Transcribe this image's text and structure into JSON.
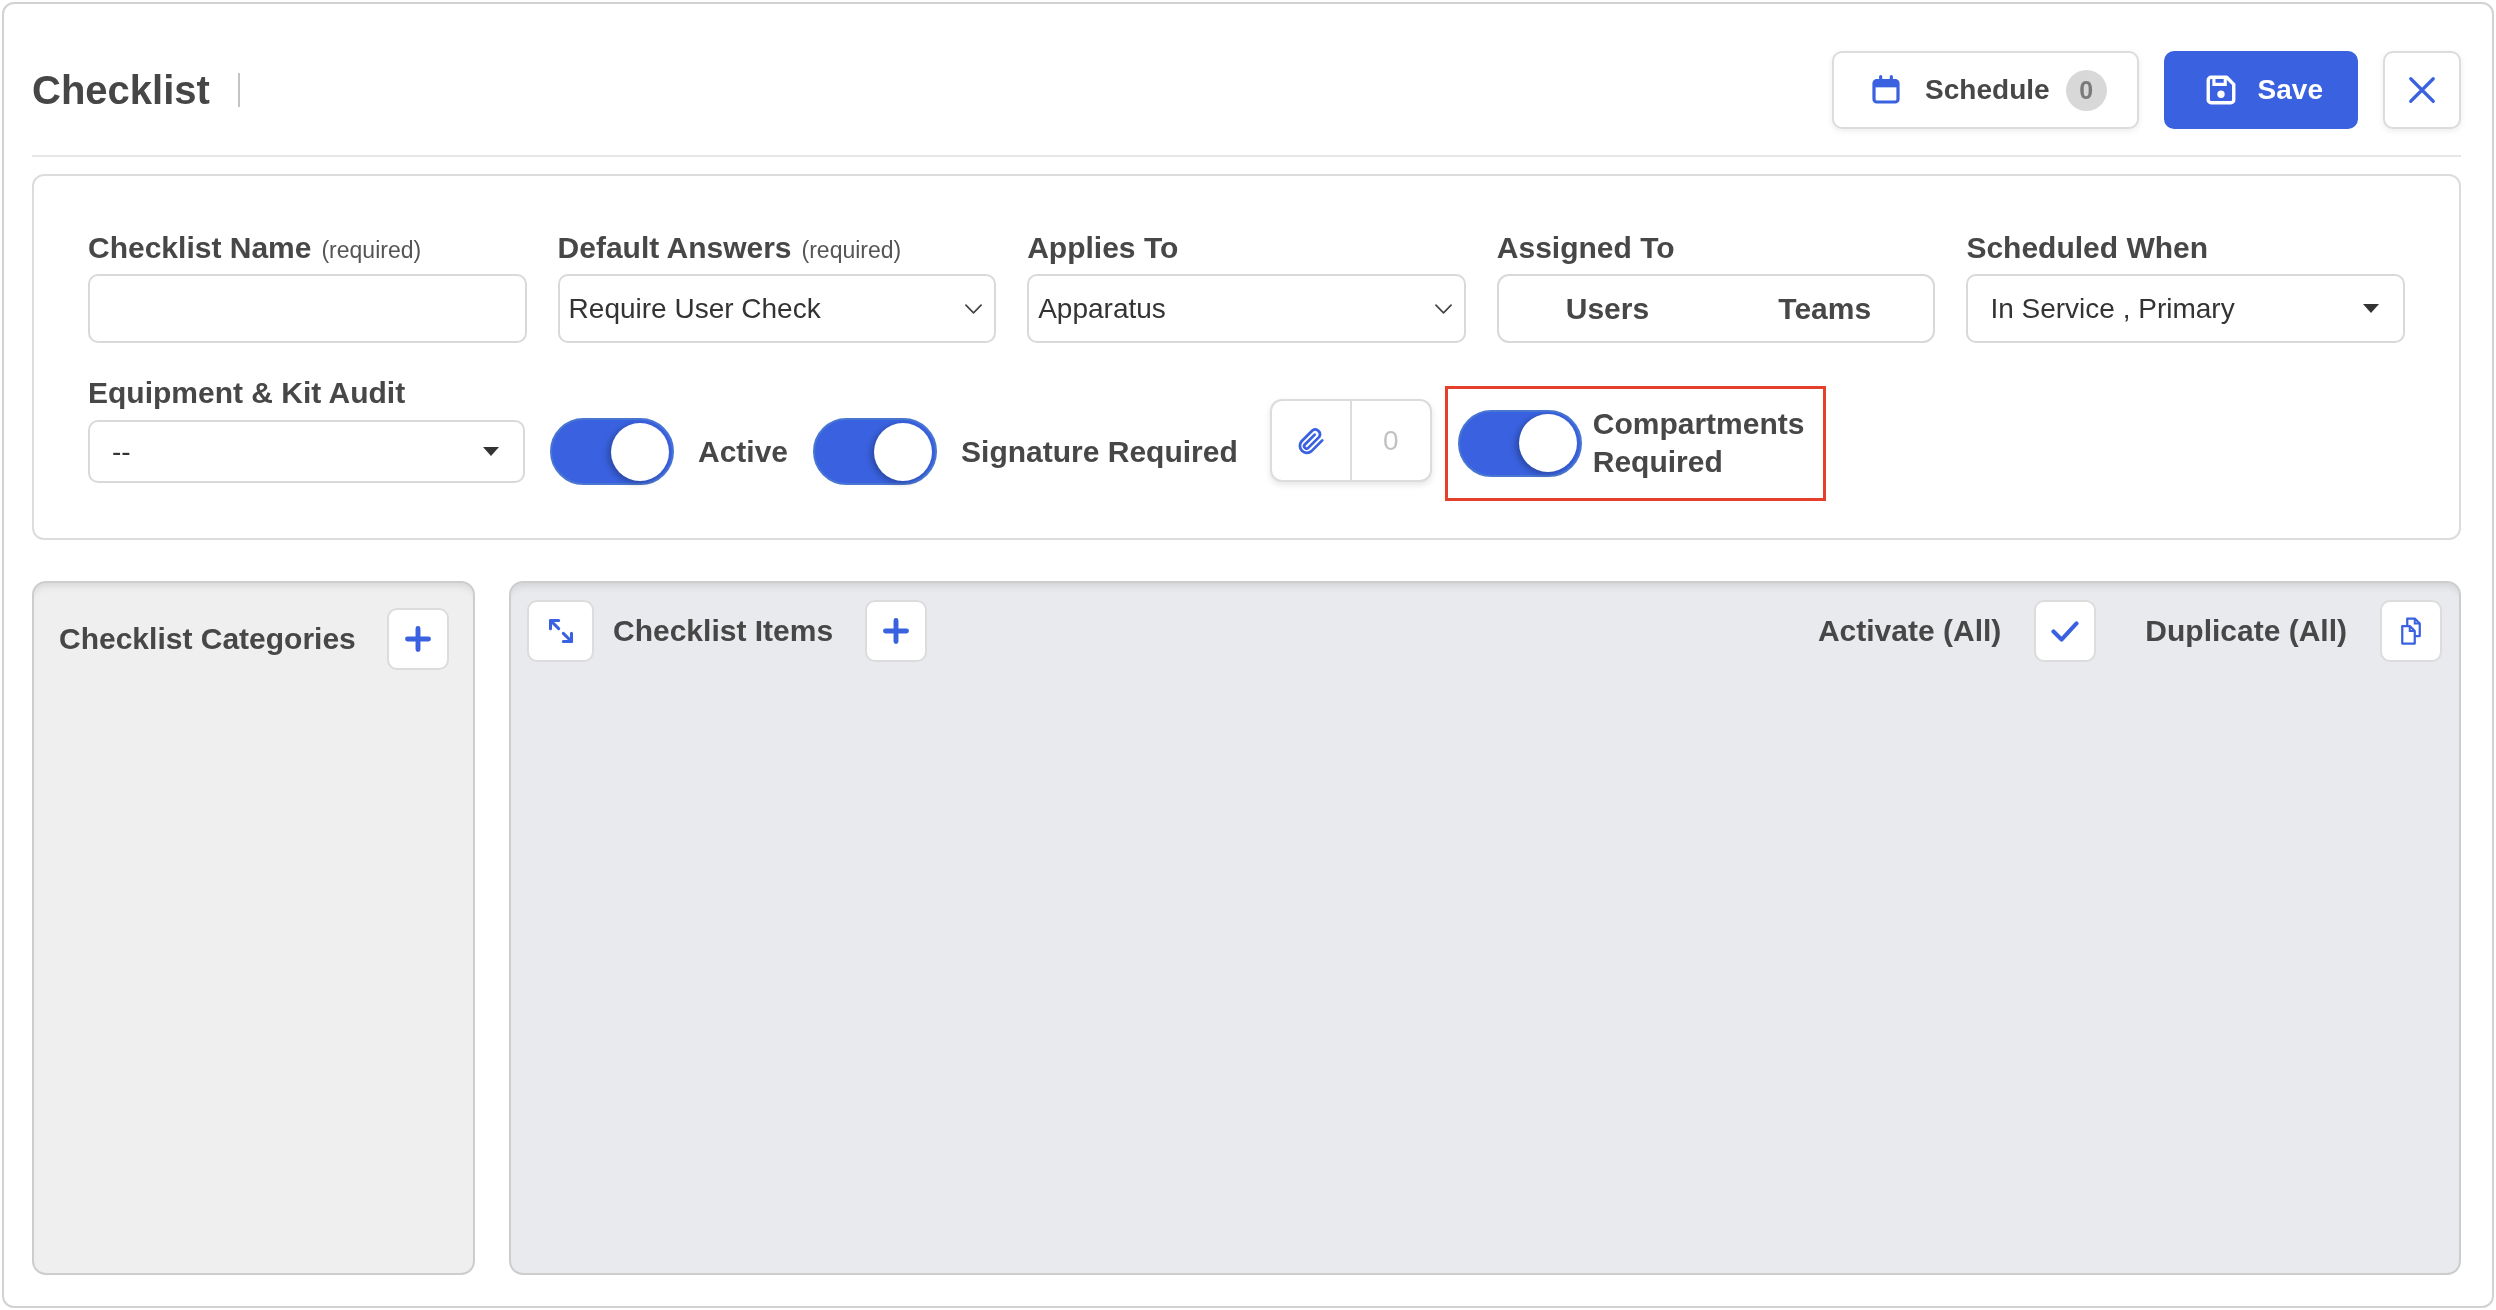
{
  "header": {
    "title": "Checklist",
    "actions": [
      {
        "kind": "schedule",
        "label": "Schedule",
        "badge": "0"
      },
      {
        "kind": "save",
        "label": "Save"
      },
      {
        "kind": "close"
      }
    ]
  },
  "form": {
    "fields": [
      {
        "kind": "text",
        "label": "Checklist Name",
        "note": "(required)"
      },
      {
        "kind": "select",
        "label": "Default Answers",
        "note": "(required)",
        "value": "Require User Check"
      },
      {
        "kind": "select",
        "label": "Applies To",
        "value": "Apparatus"
      },
      {
        "kind": "segmented",
        "label": "Assigned To",
        "options": [
          {
            "label": "Users",
            "selected": false
          },
          {
            "label": "Teams",
            "selected": false
          }
        ]
      },
      {
        "kind": "dropdown",
        "label": "Scheduled When",
        "value": "In Service , Primary"
      }
    ],
    "controls": [
      {
        "kind": "dropdown",
        "label": "Equipment & Kit Audit",
        "value": "--"
      },
      {
        "kind": "toggle",
        "label": "Active",
        "on": true,
        "highlighted": false
      },
      {
        "kind": "toggle",
        "label": "Signature Required",
        "on": true,
        "highlighted": false
      },
      {
        "kind": "attachments",
        "count": "0"
      },
      {
        "kind": "toggle",
        "label": "Compartments Required",
        "on": true,
        "highlighted": true
      }
    ]
  },
  "categories_panel": {
    "title": "Checklist Categories"
  },
  "items_panel": {
    "title": "Checklist Items",
    "actions": [
      {
        "kind": "activate",
        "label": "Activate (All)"
      },
      {
        "kind": "duplicate",
        "label": "Duplicate (All)"
      }
    ]
  }
}
